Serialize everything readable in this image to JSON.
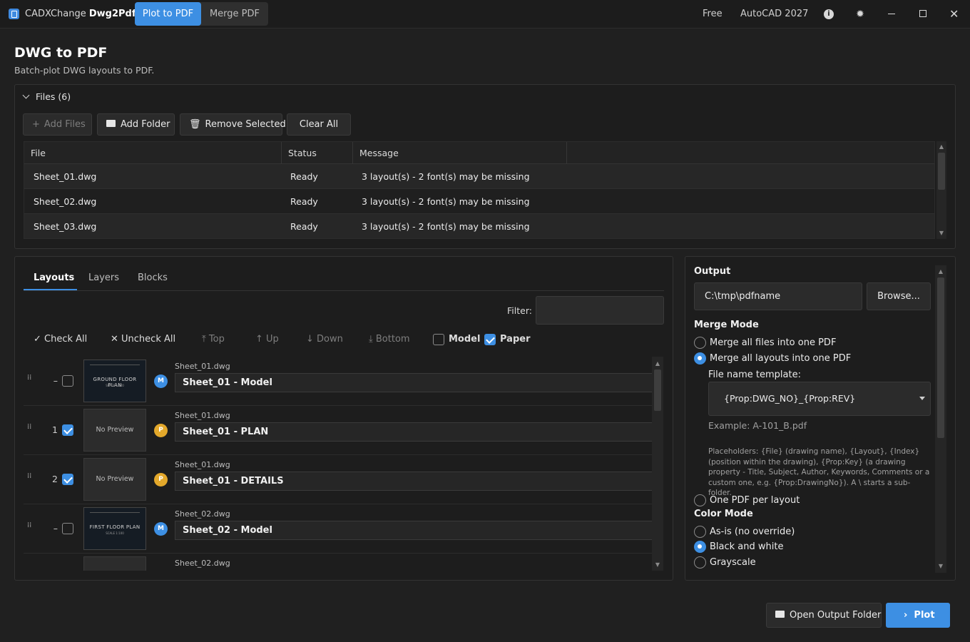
{
  "app": {
    "name_light": "CADXChange",
    "name_bold": "Dwg2Pdf"
  },
  "mode_tabs": [
    "Plot to PDF",
    "Merge PDF"
  ],
  "titlebar": {
    "plan": "Free",
    "autocad": "AutoCAD 2027",
    "info_icon": "info-icon",
    "settings_icon": "sun-icon",
    "info_glyph": "i",
    "theme_glyph": "✹",
    "close_glyph": "✕"
  },
  "page": {
    "title": "DWG to PDF",
    "subtitle": "Batch-plot DWG layouts to PDF."
  },
  "files_panel": {
    "header": "Files (6)",
    "buttons": {
      "add_files": "Add Files",
      "add_folder": "Add Folder",
      "remove_selected": "Remove Selected",
      "clear_all": "Clear All"
    },
    "columns": [
      "File",
      "Status",
      "Message"
    ],
    "rows": [
      {
        "file": "Sheet_01.dwg",
        "status": "Ready",
        "message": "3 layout(s) - 2 font(s) may be missing"
      },
      {
        "file": "Sheet_02.dwg",
        "status": "Ready",
        "message": "3 layout(s) - 2 font(s) may be missing"
      },
      {
        "file": "Sheet_03.dwg",
        "status": "Ready",
        "message": "3 layout(s) - 2 font(s) may be missing"
      }
    ]
  },
  "layouts_panel": {
    "tabs": [
      "Layouts",
      "Layers",
      "Blocks"
    ],
    "filter_label": "Filter:",
    "filter_value": "",
    "toolbar": {
      "check_all": "Check All",
      "uncheck_all": "Uncheck All",
      "top": "Top",
      "up": "Up",
      "down": "Down",
      "bottom": "Bottom",
      "model": "Model",
      "paper": "Paper",
      "model_checked": false,
      "paper_checked": true
    },
    "items": [
      {
        "index": "–",
        "checked": false,
        "thumb_title": "GROUND FLOOR PLAN",
        "thumb_sub": "SCALE 1:100",
        "badge": "M",
        "file": "Sheet_01.dwg",
        "name": "Sheet_01 - Model"
      },
      {
        "index": "1",
        "checked": true,
        "thumb_text": "No Preview",
        "badge": "P",
        "file": "Sheet_01.dwg",
        "name": "Sheet_01 - PLAN"
      },
      {
        "index": "2",
        "checked": true,
        "thumb_text": "No Preview",
        "badge": "P",
        "file": "Sheet_01.dwg",
        "name": "Sheet_01 - DETAILS"
      },
      {
        "index": "–",
        "checked": false,
        "thumb_title": "FIRST FLOOR PLAN",
        "thumb_sub": "SCALE 1:100",
        "badge": "M",
        "file": "Sheet_02.dwg",
        "name": "Sheet_02 - Model"
      },
      {
        "index": "",
        "checked": false,
        "thumb_text": "",
        "badge": "",
        "file": "Sheet_02.dwg",
        "name": ""
      }
    ]
  },
  "output_panel": {
    "output_label": "Output",
    "output_path": "C:\\tmp\\pdfname",
    "browse": "Browse...",
    "merge_mode_label": "Merge Mode",
    "merge_options": [
      "Merge all files into one PDF",
      "Merge all layouts into one PDF",
      "One PDF per layout"
    ],
    "merge_selected": "Merge all layouts into one PDF",
    "template_label": "File name template:",
    "template_value": "{Prop:DWG_NO}_{Prop:REV}",
    "example": "Example: A-101_B.pdf",
    "help": "Placeholders: {File} (drawing name), {Layout}, {Index} (position within the drawing), {Prop:Key} (a drawing property - Title, Subject, Author, Keywords, Comments or a custom one, e.g. {Prop:DrawingNo}). A \\ starts a sub-folder.",
    "color_mode_label": "Color Mode",
    "color_options": [
      "As-is (no override)",
      "Black and white",
      "Grayscale"
    ],
    "color_selected": "Black and white"
  },
  "footer": {
    "open_output": "Open Output Folder",
    "plot": "Plot"
  },
  "colors": {
    "accent": "#3d8fe3",
    "paper_badge": "#e3a82b",
    "background": "#202020"
  }
}
